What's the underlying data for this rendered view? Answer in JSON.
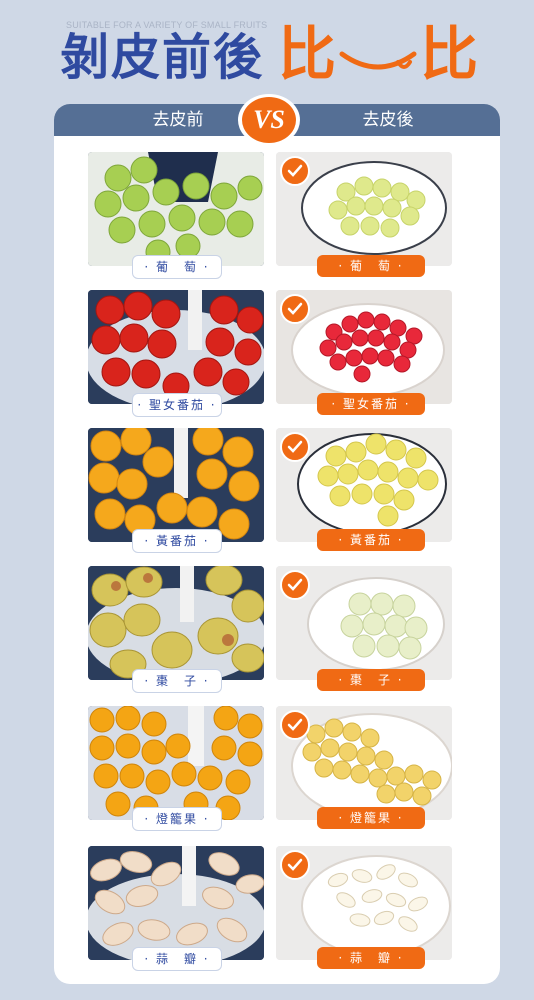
{
  "header": {
    "subtitle": "SUITABLE FOR A VARIETY OF SMALL FRUITS",
    "title": "剝皮前後",
    "compare_char": "比",
    "accent": "#f06a14",
    "primary": "#2f4aa0"
  },
  "comparison": {
    "before_label": "去皮前",
    "vs_label": "VS",
    "after_label": "去皮後",
    "header_bar_color": "#556f95"
  },
  "rows": [
    {
      "before_tag": "· 葡　萄 ·",
      "after_tag": "· 葡　萄 ·"
    },
    {
      "before_tag": "· 聖女番茄 ·",
      "after_tag": "· 聖女番茄 ·"
    },
    {
      "before_tag": "· 黃番茄 ·",
      "after_tag": "· 黃番茄 ·"
    },
    {
      "before_tag": "· 棗　子 ·",
      "after_tag": "· 棗　子 ·"
    },
    {
      "before_tag": "· 燈籠果 ·",
      "after_tag": "· 燈籠果 ·"
    },
    {
      "before_tag": "· 蒜　瓣 ·",
      "after_tag": "· 蒜　瓣 ·"
    }
  ]
}
